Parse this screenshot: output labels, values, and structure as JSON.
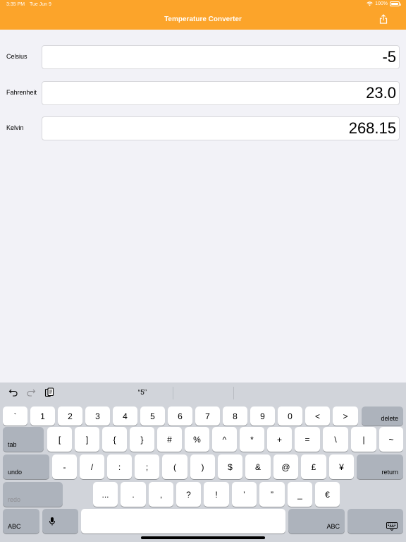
{
  "status": {
    "time": "3:35 PM",
    "date": "Tue Jun 9",
    "battery": "100%"
  },
  "nav": {
    "title": "Temperature Converter",
    "share_icon": "share-icon"
  },
  "fields": [
    {
      "label": "Celsius",
      "value": "-5"
    },
    {
      "label": "Fahrenheit",
      "value": "23.0"
    },
    {
      "label": "Kelvin",
      "value": "268.15"
    }
  ],
  "keyboard": {
    "suggestion": "“5”",
    "row1": [
      "`",
      "1",
      "2",
      "3",
      "4",
      "5",
      "6",
      "7",
      "8",
      "9",
      "0",
      "<",
      ">"
    ],
    "row1_delete": "delete",
    "row2_tab": "tab",
    "row2": [
      "[",
      "]",
      "{",
      "}",
      "#",
      "%",
      "^",
      "*",
      "+",
      "=",
      "\\",
      "|",
      "~"
    ],
    "row3_undo": "undo",
    "row3": [
      "-",
      "/",
      ":",
      ";",
      "(",
      ")",
      "$",
      "&",
      "@",
      "£",
      "¥"
    ],
    "row3_return": "return",
    "row4_redo": "redo",
    "row4": [
      "...",
      ".",
      ",",
      "?",
      "!",
      "’",
      "”",
      "_",
      "€"
    ],
    "row5_abc_left": "ABC",
    "row5_abc_right": "ABC"
  },
  "colors": {
    "accent": "#fca42a",
    "background": "#f2f2f7",
    "keyboard": "#d1d4da"
  }
}
